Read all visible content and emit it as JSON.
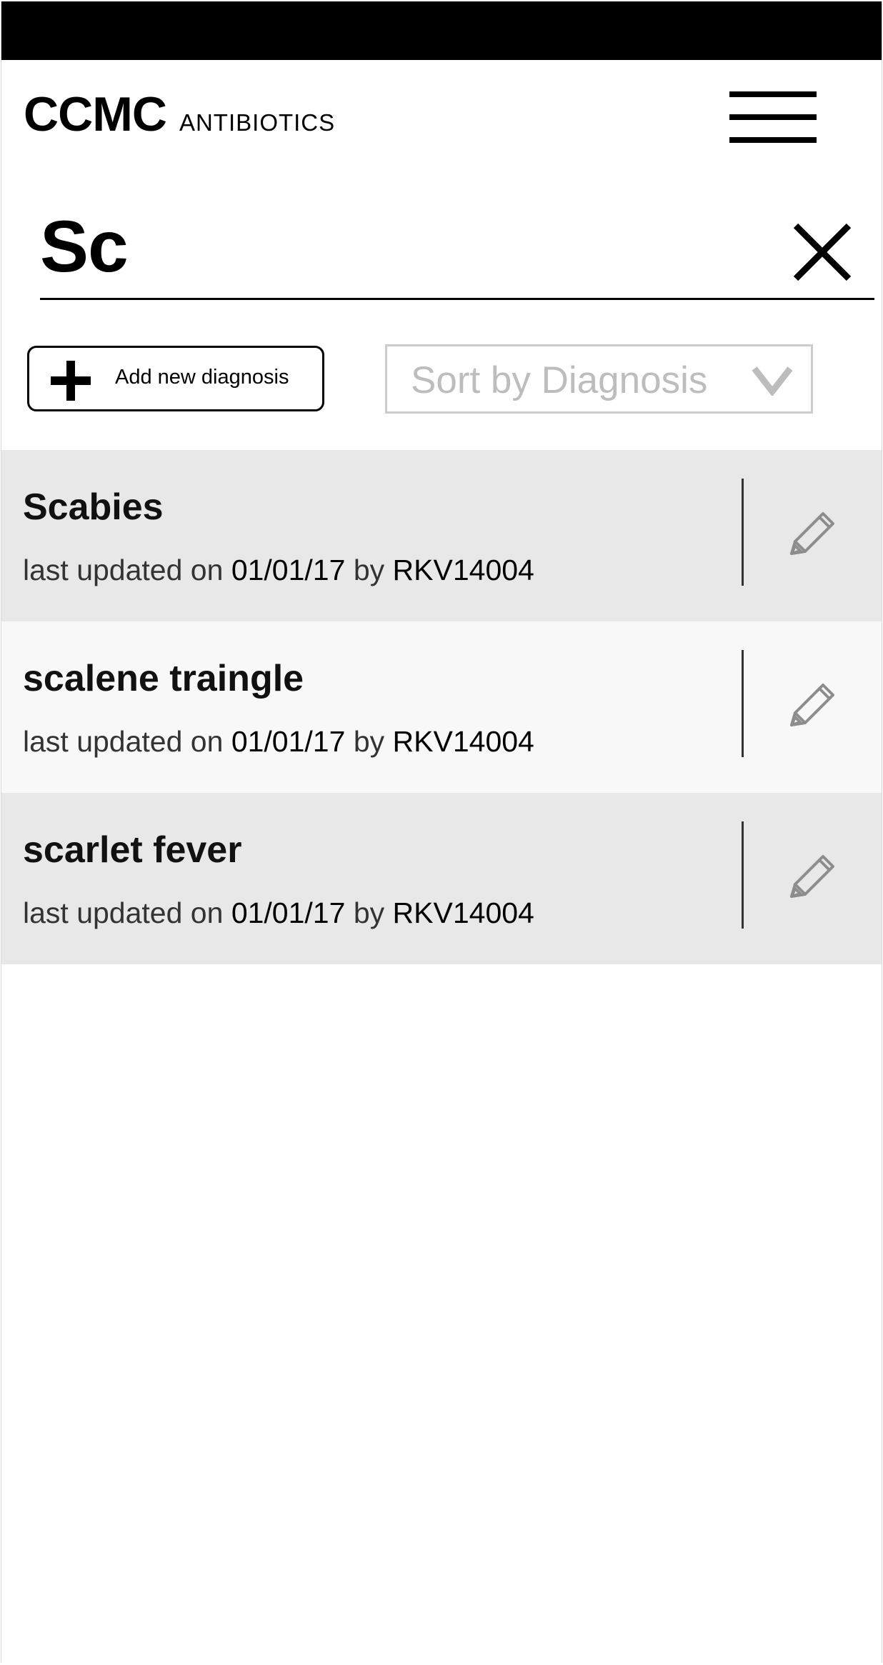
{
  "header": {
    "brand": "CCMC",
    "subtitle": "ANTIBIOTICS",
    "menu_icon": "hamburger-menu-icon"
  },
  "search": {
    "value": "Sc",
    "clear_icon": "close-icon"
  },
  "toolbar": {
    "add_label": "Add new diagnosis",
    "add_icon": "plus-icon",
    "sort_label": "Sort by Diagnosis",
    "sort_icon": "chevron-down-icon"
  },
  "results": [
    {
      "title": "Scabies",
      "prefix": "last updated on",
      "date": "01/01/17",
      "by": "by",
      "user": "RKV14004",
      "edit_icon": "pencil-icon"
    },
    {
      "title": "scalene traingle",
      "prefix": "last updated on",
      "date": "01/01/17",
      "by": "by",
      "user": "RKV14004",
      "edit_icon": "pencil-icon"
    },
    {
      "title": "scarlet fever",
      "prefix": "last updated on",
      "date": "01/01/17",
      "by": "by",
      "user": "RKV14004",
      "edit_icon": "pencil-icon"
    }
  ],
  "colors": {
    "row_shaded": "#e8e8e8",
    "row_light": "#f8f8f8",
    "muted_text": "#bdbdbd",
    "black": "#000000"
  }
}
